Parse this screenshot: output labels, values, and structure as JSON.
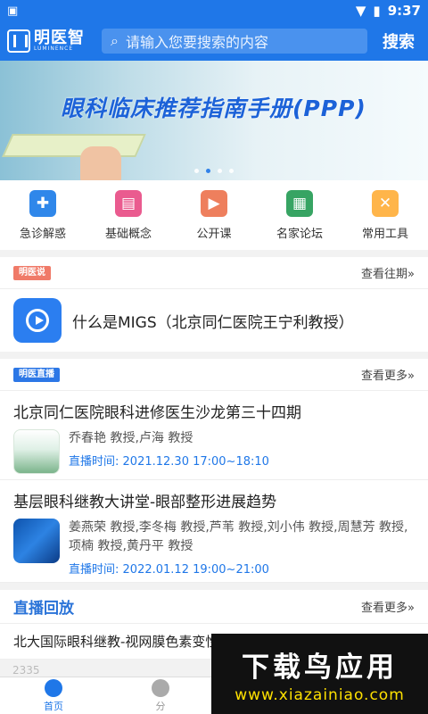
{
  "status": {
    "time": "9:37"
  },
  "header": {
    "logo_cn": "明医智",
    "logo_en": "LUMINENCE",
    "search_placeholder": "请输入您要搜索的内容",
    "search_button": "搜索"
  },
  "banner": {
    "title": "眼科临床推荐指南手册(PPP)"
  },
  "menu": [
    {
      "label": "急诊解惑",
      "icon": "emergency-icon",
      "color": "#2f87ea"
    },
    {
      "label": "基础概念",
      "icon": "book-icon",
      "color": "#ea5b8f"
    },
    {
      "label": "公开课",
      "icon": "video-icon",
      "color": "#ee7f5d"
    },
    {
      "label": "名家论坛",
      "icon": "forum-icon",
      "color": "#37a463"
    },
    {
      "label": "常用工具",
      "icon": "tools-icon",
      "color": "#ffb54a"
    }
  ],
  "section_talk": {
    "tag": "明医说",
    "more": "查看往期»",
    "video_title": "什么是MIGS（北京同仁医院王宁利教授）"
  },
  "section_live": {
    "tag": "明医直播",
    "more": "查看更多»",
    "items": [
      {
        "title": "北京同仁医院眼科进修医生沙龙第三十四期",
        "speakers": "乔春艳 教授,卢海 教授",
        "time_label": "直播时间:",
        "time": "2021.12.30 17:00~18:10"
      },
      {
        "title": "基层眼科继教大讲堂-眼部整形进展趋势",
        "speakers": "姜燕荣 教授,李冬梅 教授,芦苇 教授,刘小伟 教授,周慧芳 教授,项楠 教授,黄丹平 教授",
        "time_label": "直播时间:",
        "time": "2022.01.12 19:00~21:00"
      }
    ]
  },
  "section_replay": {
    "title": "直播回放",
    "more": "查看更多»",
    "item": "北大国际眼科继教-视网膜色素变性",
    "views": "2335"
  },
  "nav": {
    "home": "首页",
    "second": "分"
  },
  "watermark": {
    "main": "下载鸟应用",
    "url": "www.xiazainiao.com"
  }
}
